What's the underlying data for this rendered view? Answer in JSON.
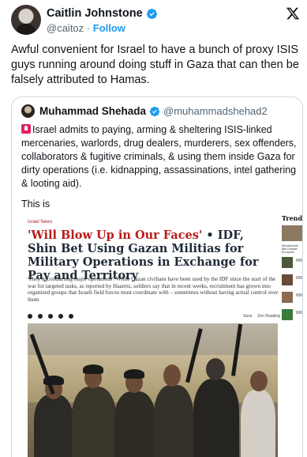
{
  "author": {
    "name": "Caitlin Johnstone",
    "handle": "@caitoz",
    "separator": "·",
    "follow_label": "Follow"
  },
  "tweet": {
    "text": "Awful convenient for Israel to have a bunch of proxy ISIS guys running around doing stuff in Gaza that can then be falsely attributed to Hamas."
  },
  "quoted": {
    "name": "Muhammad Shehada",
    "handle": "@muhammadshehad2",
    "body": "Israel admits to paying, arming & sheltering ISIS-linked mercenaries, warlords, drug dealers, murderers, sex offenders, collaborators & fugitive criminals, & using them inside Gaza for dirty operations (i.e. kidnapping, assassinations, intel gathering & looting aid).",
    "footer": "This is"
  },
  "article": {
    "kicker": "Israel News",
    "title_quote": "'Will Blow Up in Our Faces'",
    "title_rest": " • IDF, Shin Bet Using Gazan Militias for Military Operations in Exchange for Pay and Territory",
    "subtitle": "'They're conducting major operations': While Gazan civilians have been used by the IDF since the start of the war for targeted tasks, as reported by Haaretz, soldiers say that in recent weeks, recruitment has grown into organized groups that Israeli field forces must coordinate with – sometimes without having actual control over them",
    "tool_save": "Save",
    "tool_zen": "Zen Reading"
  },
  "sidebar": {
    "heading": "Trending",
    "item1": "Slovakia Arts Ban Despite European"
  },
  "colors": {
    "verified": "#1d9bf0",
    "accent_red": "#b91c1c",
    "siren": "#e0245e"
  },
  "icons": [
    "verified-badge-icon",
    "x-logo-icon",
    "siren-icon"
  ]
}
